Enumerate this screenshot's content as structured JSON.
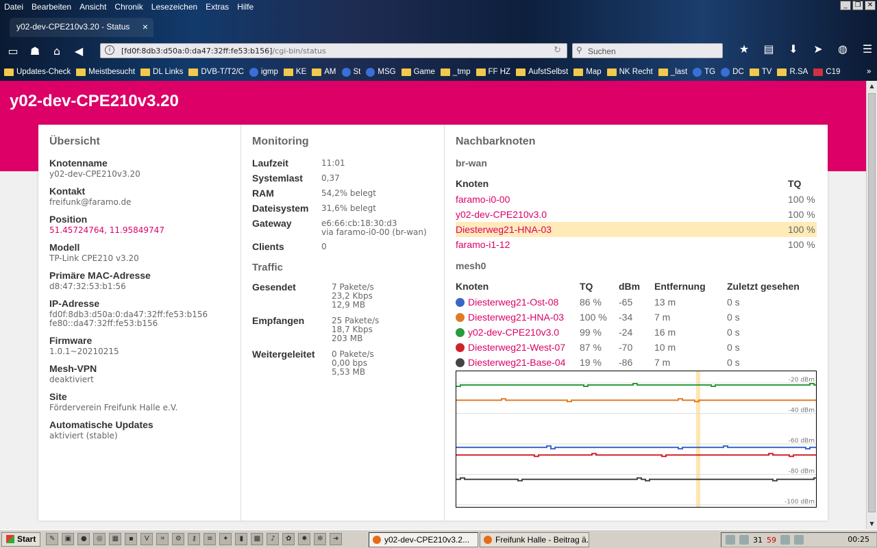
{
  "menubar": {
    "items": [
      "Datei",
      "Bearbeiten",
      "Ansicht",
      "Chronik",
      "Lesezeichen",
      "Extras",
      "Hilfe"
    ]
  },
  "tab": {
    "title": "y02-dev-CPE210v3.20 - Status",
    "close": "×"
  },
  "urlbar": {
    "host": "[fd0f:8db3:d50a:0:da47:32ff:fe53:b156]",
    "path": "/cgi-bin/status"
  },
  "search": {
    "placeholder": "Suchen"
  },
  "bookmarks": [
    {
      "label": "Updates-Check",
      "icon": "folder"
    },
    {
      "label": "Meistbesucht",
      "icon": "folder"
    },
    {
      "label": "DL Links",
      "icon": "folder"
    },
    {
      "label": "DVB-T/T2/C",
      "icon": "folder"
    },
    {
      "label": "igmp",
      "icon": "google"
    },
    {
      "label": "KE",
      "icon": "folder"
    },
    {
      "label": "AM",
      "icon": "folder"
    },
    {
      "label": "St",
      "icon": "facebook"
    },
    {
      "label": "MSG",
      "icon": "facebook"
    },
    {
      "label": "Game",
      "icon": "folder"
    },
    {
      "label": "_tmp",
      "icon": "folder"
    },
    {
      "label": "FF HZ",
      "icon": "folder"
    },
    {
      "label": "AufstSelbst",
      "icon": "folder"
    },
    {
      "label": "Map",
      "icon": "folder"
    },
    {
      "label": "NK Recht",
      "icon": "folder"
    },
    {
      "label": "_last",
      "icon": "folder"
    },
    {
      "label": "TG",
      "icon": "telegram"
    },
    {
      "label": "DC",
      "icon": "discord"
    },
    {
      "label": "TV",
      "icon": "folder"
    },
    {
      "label": "R.SA",
      "icon": "rsa"
    },
    {
      "label": "C19",
      "icon": "c19"
    }
  ],
  "page": {
    "title": "y02-dev-CPE210v3.20",
    "overview": {
      "title": "Übersicht",
      "fields": [
        {
          "label": "Knotenname",
          "value": "y02-dev-CPE210v3.20"
        },
        {
          "label": "Kontakt",
          "value": "freifunk@faramo.de"
        },
        {
          "label": "Position",
          "value": "51.45724764, 11.95849747",
          "link": true
        },
        {
          "label": "Modell",
          "value": "TP-Link CPE210 v3.20"
        },
        {
          "label": "Primäre MAC-Adresse",
          "value": "d8:47:32:53:b1:56"
        },
        {
          "label": "IP-Adresse",
          "value": "fd0f:8db3:d50a:0:da47:32ff:fe53:b156",
          "value2": "fe80::da47:32ff:fe53:b156"
        },
        {
          "label": "Firmware",
          "value": "1.0.1~20210215"
        },
        {
          "label": "Mesh-VPN",
          "value": "deaktiviert"
        },
        {
          "label": "Site",
          "value": "Förderverein Freifunk Halle e.V."
        },
        {
          "label": "Automatische Updates",
          "value": "aktiviert (stable)"
        }
      ]
    },
    "monitoring": {
      "title": "Monitoring",
      "rows": [
        {
          "label": "Laufzeit",
          "value": "11:01"
        },
        {
          "label": "Systemlast",
          "value": "0,37"
        },
        {
          "label": "RAM",
          "value": "54,2% belegt"
        },
        {
          "label": "Dateisystem",
          "value": "31,6% belegt"
        },
        {
          "label": "Gateway",
          "value": "e6:66:cb:18:30:d3",
          "value2": "via faramo-i0-00 (br-wan)"
        },
        {
          "label": "Clients",
          "value": "0"
        }
      ],
      "traffic_title": "Traffic",
      "traffic": [
        {
          "label": "Gesendet",
          "l1": "7 Pakete/s",
          "l2": "23,2 Kbps",
          "l3": "12,9 MB"
        },
        {
          "label": "Empfangen",
          "l1": "25 Pakete/s",
          "l2": "18,7 Kbps",
          "l3": "203 MB"
        },
        {
          "label": "Weitergeleitet",
          "l1": "0 Pakete/s",
          "l2": "0,00 bps",
          "l3": "5,53 MB"
        }
      ]
    },
    "neighbours": {
      "title": "Nachbarknoten",
      "brwan": {
        "title": "br-wan",
        "headers": [
          "Knoten",
          "TQ"
        ],
        "rows": [
          {
            "node": "faramo-i0-00",
            "tq": "100 %"
          },
          {
            "node": "y02-dev-CPE210v3.0",
            "tq": "100 %"
          },
          {
            "node": "Diesterweg21-HNA-03",
            "tq": "100 %",
            "highlight": true
          },
          {
            "node": "faramo-i1-12",
            "tq": "100 %"
          }
        ]
      },
      "mesh0": {
        "title": "mesh0",
        "headers": [
          "Knoten",
          "TQ",
          "dBm",
          "Entfernung",
          "Zuletzt gesehen"
        ],
        "rows": [
          {
            "color": "#3a66c4",
            "node": "Diesterweg21-Ost-08",
            "tq": "86 %",
            "dbm": "-65",
            "dist": "13 m",
            "seen": "0 s"
          },
          {
            "color": "#e07b25",
            "node": "Diesterweg21-HNA-03",
            "tq": "100 %",
            "dbm": "-34",
            "dist": "7 m",
            "seen": "0 s"
          },
          {
            "color": "#2a9a3f",
            "node": "y02-dev-CPE210v3.0",
            "tq": "99 %",
            "dbm": "-24",
            "dist": "16 m",
            "seen": "0 s"
          },
          {
            "color": "#d02228",
            "node": "Diesterweg21-West-07",
            "tq": "87 %",
            "dbm": "-70",
            "dist": "10 m",
            "seen": "0 s"
          },
          {
            "color": "#444444",
            "node": "Diesterweg21-Base-04",
            "tq": "19 %",
            "dbm": "-86",
            "dist": "7 m",
            "seen": "0 s"
          }
        ]
      }
    }
  },
  "chart_data": {
    "type": "line",
    "ylim": [
      -105,
      -15
    ],
    "yticks": [
      -20,
      -40,
      -60,
      -80,
      -100
    ],
    "ytick_labels": [
      "-20 dBm",
      "-40 dBm",
      "-60 dBm",
      "-80 dBm",
      "-100 dBm"
    ],
    "grid": true,
    "series": [
      {
        "name": "y02-dev-CPE210v3.0",
        "color": "#2a9a3f",
        "level": -24
      },
      {
        "name": "Diesterweg21-HNA-03",
        "color": "#e07b25",
        "level": -34
      },
      {
        "name": "Diesterweg21-Ost-08",
        "color": "#3a66c4",
        "level": -65
      },
      {
        "name": "Diesterweg21-West-07",
        "color": "#d02228",
        "level": -70
      },
      {
        "name": "Diesterweg21-Base-04",
        "color": "#444444",
        "level": -86
      }
    ],
    "marker_color": "#ffe5b0"
  },
  "taskbar": {
    "start": "Start",
    "tasks": [
      {
        "label": "y02-dev-CPE210v3.2...",
        "active": true
      },
      {
        "label": "Freifunk Halle - Beitrag ä...",
        "active": false
      }
    ],
    "tray_a": "31",
    "tray_b": "59",
    "clock": "00:25"
  },
  "colors": {
    "accent": "#dc0067",
    "highlight": "#ffeab8"
  }
}
